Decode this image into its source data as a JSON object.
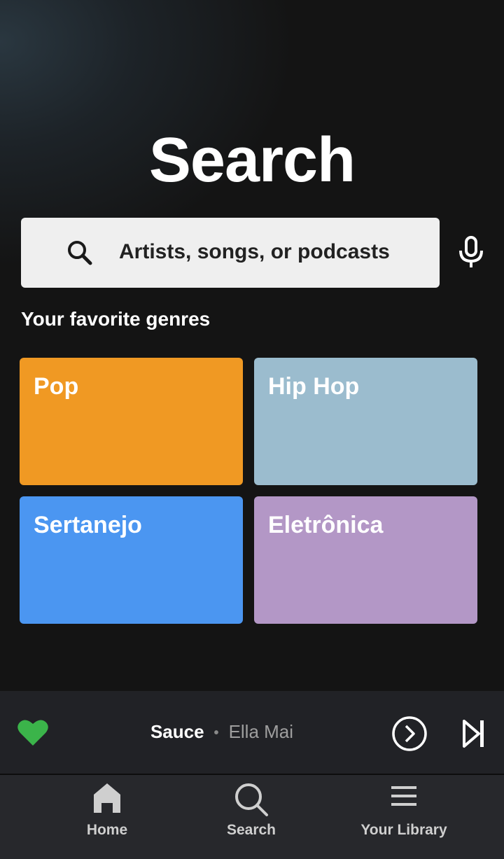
{
  "header": {
    "title": "Search"
  },
  "search": {
    "placeholder": "Artists, songs, or podcasts"
  },
  "genres": {
    "section_title": "Your favorite genres",
    "items": [
      {
        "label": "Pop",
        "color": "#f09923"
      },
      {
        "label": "Hip Hop",
        "color": "#9bbcce"
      },
      {
        "label": "Sertanejo",
        "color": "#4b96f1"
      },
      {
        "label": "Eletrônica",
        "color": "#b397c6"
      }
    ]
  },
  "now_playing": {
    "title": "Sauce",
    "separator": "•",
    "artist": "Ella Mai",
    "liked": true,
    "like_color": "#3bb44a"
  },
  "nav": {
    "items": [
      {
        "label": "Home",
        "icon": "home-icon",
        "active": true
      },
      {
        "label": "Search",
        "icon": "search-icon",
        "active": false
      },
      {
        "label": "Your Library",
        "icon": "library-icon",
        "active": false
      }
    ]
  }
}
